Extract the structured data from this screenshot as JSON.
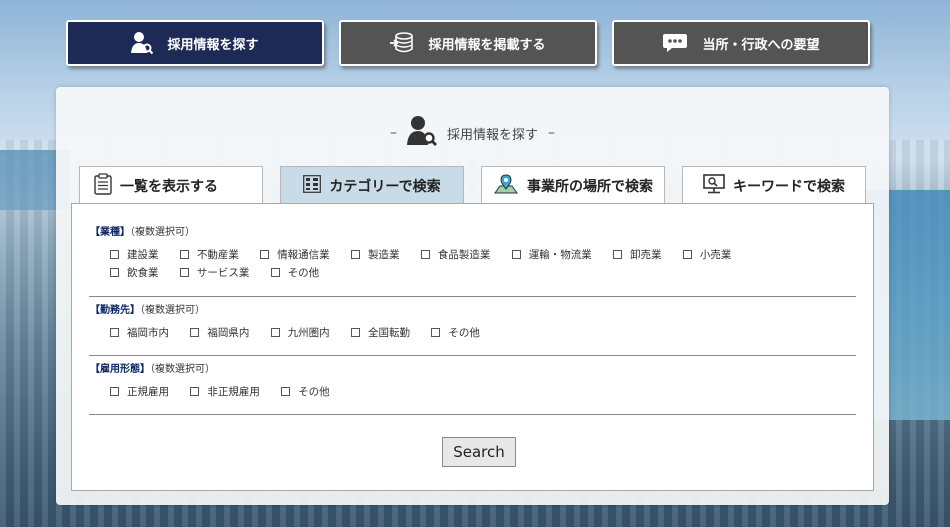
{
  "nav": {
    "find_label": "採用情報を探す",
    "post_label": "採用情報を掲載する",
    "request_label": "当所・行政への要望"
  },
  "panel": {
    "dash_left": "–",
    "title": "採用情報を探す",
    "dash_right": "–"
  },
  "tabs": [
    {
      "label": "一覧を表示する",
      "icon": "clipboard-icon"
    },
    {
      "label": "カテゴリーで検索",
      "icon": "category-grid-icon"
    },
    {
      "label": "事業所の場所で検索",
      "icon": "map-pin-icon"
    },
    {
      "label": "キーワードで検索",
      "icon": "monitor-icon"
    }
  ],
  "active_tab_color": "#c9dbe6",
  "sections": {
    "industry": {
      "title": "【業種】",
      "note": "（複数選択可）",
      "options": [
        "建設業",
        "不動産業",
        "情報通信業",
        "製造業",
        "食品製造業",
        "運輸・物流業",
        "卸売業",
        "小売業",
        "飲食業",
        "サービス業",
        "その他"
      ]
    },
    "workplace": {
      "title": "【勤務先】",
      "note": "（複数選択可）",
      "options": [
        "福岡市内",
        "福岡県内",
        "九州圏内",
        "全国転勤",
        "その他"
      ]
    },
    "employment": {
      "title": "【雇用形態】",
      "note": "（複数選択可）",
      "options": [
        "正規雇用",
        "非正規雇用",
        "その他"
      ]
    }
  },
  "search_label": "Search",
  "colors": {
    "nav_active": "#1c2a55",
    "nav_inactive": "#545454",
    "heading": "#0e2866"
  }
}
